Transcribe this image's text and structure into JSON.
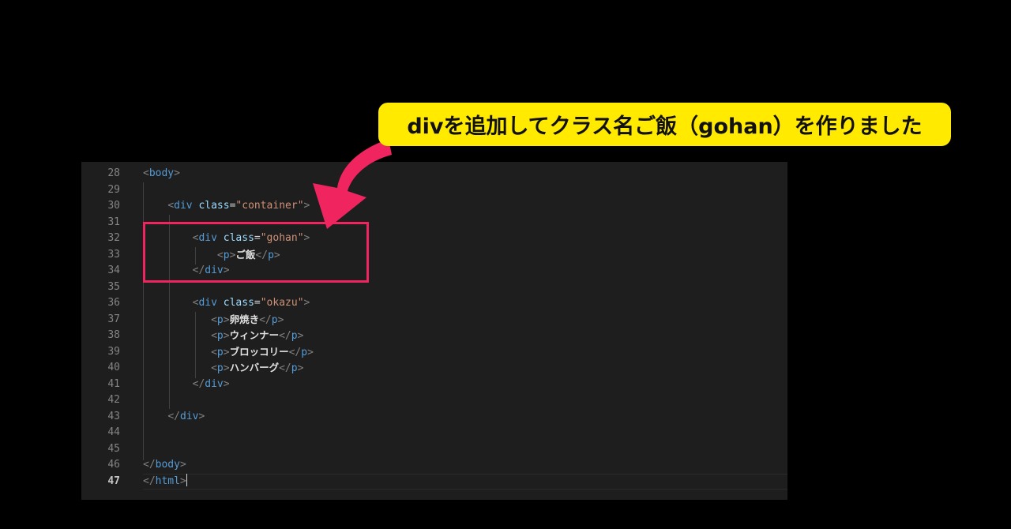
{
  "annotation": {
    "callout_text": "divを追加してクラス名ご飯（gohan）を作りました",
    "arrow_color": "#f0245f",
    "box_color": "#f0245f",
    "callout_bg": "#ffea00"
  },
  "editor": {
    "lines": [
      {
        "num": "28",
        "code": [
          [
            "punc",
            "<"
          ],
          [
            "tag",
            "body"
          ],
          [
            "punc",
            ">"
          ]
        ]
      },
      {
        "num": "29",
        "code": []
      },
      {
        "num": "30",
        "code": [
          [
            "sp",
            "    "
          ],
          [
            "punc",
            "<"
          ],
          [
            "tag",
            "div"
          ],
          [
            "sp",
            " "
          ],
          [
            "attr",
            "class"
          ],
          [
            "eq",
            "="
          ],
          [
            "str",
            "\"container\""
          ],
          [
            "punc",
            ">"
          ]
        ]
      },
      {
        "num": "31",
        "code": []
      },
      {
        "num": "32",
        "code": [
          [
            "sp",
            "        "
          ],
          [
            "punc",
            "<"
          ],
          [
            "tag",
            "div"
          ],
          [
            "sp",
            " "
          ],
          [
            "attr",
            "class"
          ],
          [
            "eq",
            "="
          ],
          [
            "str",
            "\"gohan\""
          ],
          [
            "punc",
            ">"
          ]
        ]
      },
      {
        "num": "33",
        "code": [
          [
            "sp",
            "            "
          ],
          [
            "punc",
            "<"
          ],
          [
            "tag",
            "p"
          ],
          [
            "punc",
            ">"
          ],
          [
            "txt",
            "ご飯"
          ],
          [
            "punc",
            "</"
          ],
          [
            "tag",
            "p"
          ],
          [
            "punc",
            ">"
          ]
        ]
      },
      {
        "num": "34",
        "code": [
          [
            "sp",
            "        "
          ],
          [
            "punc",
            "</"
          ],
          [
            "tag",
            "div"
          ],
          [
            "punc",
            ">"
          ]
        ]
      },
      {
        "num": "35",
        "code": []
      },
      {
        "num": "36",
        "code": [
          [
            "sp",
            "        "
          ],
          [
            "punc",
            "<"
          ],
          [
            "tag",
            "div"
          ],
          [
            "sp",
            " "
          ],
          [
            "attr",
            "class"
          ],
          [
            "eq",
            "="
          ],
          [
            "str",
            "\"okazu\""
          ],
          [
            "punc",
            ">"
          ]
        ]
      },
      {
        "num": "37",
        "code": [
          [
            "sp",
            "           "
          ],
          [
            "punc",
            "<"
          ],
          [
            "tag",
            "p"
          ],
          [
            "punc",
            ">"
          ],
          [
            "txt",
            "卵焼き"
          ],
          [
            "punc",
            "</"
          ],
          [
            "tag",
            "p"
          ],
          [
            "punc",
            ">"
          ]
        ]
      },
      {
        "num": "38",
        "code": [
          [
            "sp",
            "           "
          ],
          [
            "punc",
            "<"
          ],
          [
            "tag",
            "p"
          ],
          [
            "punc",
            ">"
          ],
          [
            "txt",
            "ウィンナー"
          ],
          [
            "punc",
            "</"
          ],
          [
            "tag",
            "p"
          ],
          [
            "punc",
            ">"
          ]
        ]
      },
      {
        "num": "39",
        "code": [
          [
            "sp",
            "           "
          ],
          [
            "punc",
            "<"
          ],
          [
            "tag",
            "p"
          ],
          [
            "punc",
            ">"
          ],
          [
            "txt",
            "ブロッコリー"
          ],
          [
            "punc",
            "</"
          ],
          [
            "tag",
            "p"
          ],
          [
            "punc",
            ">"
          ]
        ]
      },
      {
        "num": "40",
        "code": [
          [
            "sp",
            "           "
          ],
          [
            "punc",
            "<"
          ],
          [
            "tag",
            "p"
          ],
          [
            "punc",
            ">"
          ],
          [
            "txt",
            "ハンバーグ"
          ],
          [
            "punc",
            "</"
          ],
          [
            "tag",
            "p"
          ],
          [
            "punc",
            ">"
          ]
        ]
      },
      {
        "num": "41",
        "code": [
          [
            "sp",
            "        "
          ],
          [
            "punc",
            "</"
          ],
          [
            "tag",
            "div"
          ],
          [
            "punc",
            ">"
          ]
        ]
      },
      {
        "num": "42",
        "code": []
      },
      {
        "num": "43",
        "code": [
          [
            "sp",
            "    "
          ],
          [
            "punc",
            "</"
          ],
          [
            "tag",
            "div"
          ],
          [
            "punc",
            ">"
          ]
        ]
      },
      {
        "num": "44",
        "code": []
      },
      {
        "num": "45",
        "code": []
      },
      {
        "num": "46",
        "code": [
          [
            "punc",
            "</"
          ],
          [
            "tag",
            "body"
          ],
          [
            "punc",
            ">"
          ]
        ]
      },
      {
        "num": "47",
        "code": [
          [
            "punc",
            "</"
          ],
          [
            "tag",
            "html"
          ],
          [
            "punc",
            ">"
          ]
        ]
      }
    ],
    "active_line": "47"
  }
}
